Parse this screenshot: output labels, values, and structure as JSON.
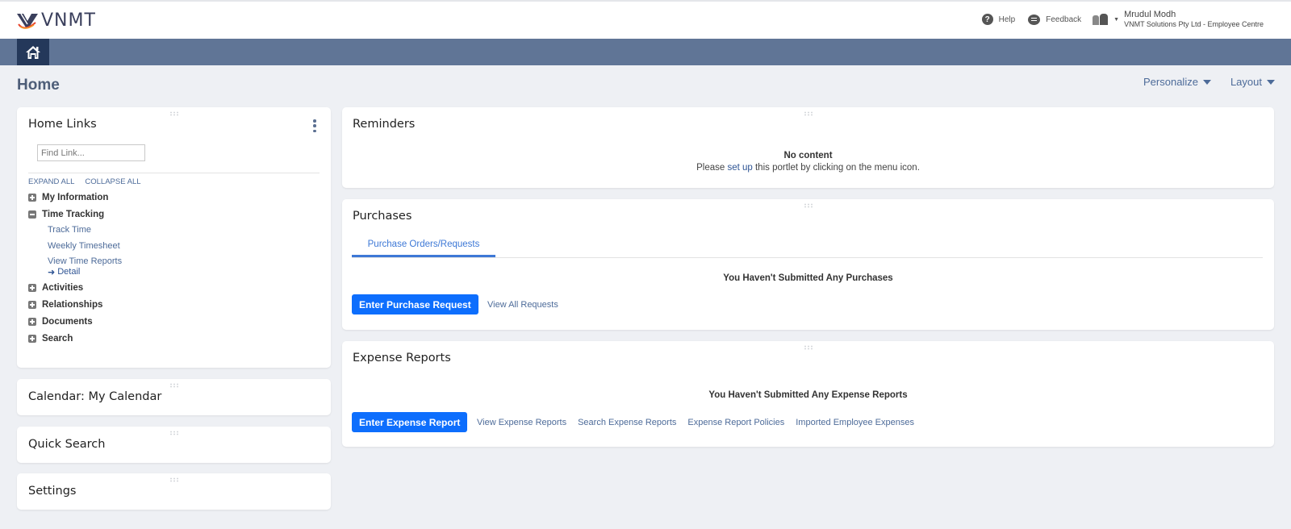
{
  "header": {
    "logo_text": "VNMT",
    "help_label": "Help",
    "help_icon_glyph": "?",
    "feedback_label": "Feedback",
    "user_name": "Mrudul Modh",
    "user_org": "VNMT Solutions Pty Ltd - Employee Centre",
    "caret_glyph": "▼"
  },
  "nav": {
    "home_icon": "home-icon"
  },
  "page": {
    "title": "Home",
    "actions": [
      {
        "label": "Personalize"
      },
      {
        "label": "Layout"
      }
    ]
  },
  "home_links": {
    "title": "Home Links",
    "find_placeholder": "Find Link...",
    "expand_all": "EXPAND ALL",
    "collapse_all": "COLLAPSE ALL",
    "tree": [
      {
        "label": "My Information",
        "expanded": false
      },
      {
        "label": "Time Tracking",
        "expanded": true,
        "children": [
          "Track Time",
          "Weekly Timesheet",
          "View Time Reports"
        ],
        "sublink": {
          "arrow": "➜",
          "label": "Detail"
        }
      },
      {
        "label": "Activities",
        "expanded": false
      },
      {
        "label": "Relationships",
        "expanded": false
      },
      {
        "label": "Documents",
        "expanded": false
      },
      {
        "label": "Search",
        "expanded": false
      }
    ]
  },
  "left_portlets": [
    {
      "title": "Calendar: My Calendar"
    },
    {
      "title": "Quick Search"
    },
    {
      "title": "Settings"
    }
  ],
  "reminders": {
    "title": "Reminders",
    "no_content": "No content",
    "msg_before": "Please ",
    "msg_link": "set up",
    "msg_after": " this portlet by clicking on the menu icon."
  },
  "purchases": {
    "title": "Purchases",
    "tab": "Purchase Orders/Requests",
    "empty_msg": "You Haven't Submitted Any Purchases",
    "primary_button": "Enter Purchase Request",
    "links": [
      "View All Requests"
    ]
  },
  "expenses": {
    "title": "Expense Reports",
    "empty_msg": "You Haven't Submitted Any Expense Reports",
    "primary_button": "Enter Expense Report",
    "links": [
      "View Expense Reports",
      "Search Expense Reports",
      "Expense Report Policies",
      "Imported Employee Expenses"
    ]
  },
  "colors": {
    "navbar": "#607596",
    "home_button": "#24385a",
    "primary": "#0d6efd",
    "link": "#4d6b99",
    "background": "#eef0f4"
  }
}
